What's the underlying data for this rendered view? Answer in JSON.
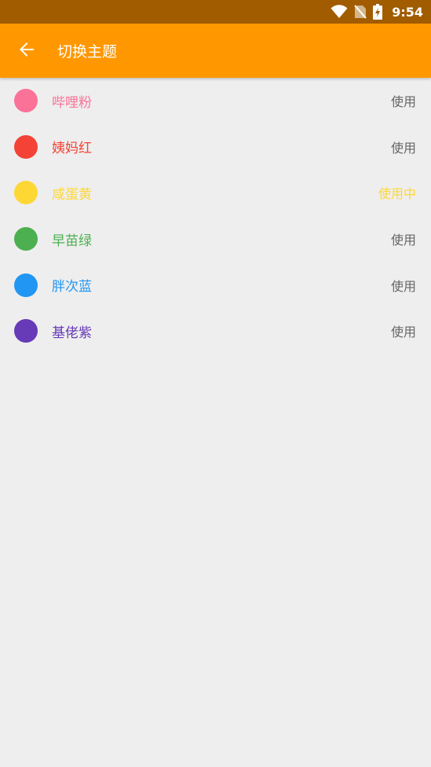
{
  "status_bar": {
    "time": "9:54",
    "icons": [
      "wifi-icon",
      "no-sim-icon",
      "battery-charging-icon"
    ]
  },
  "app_bar": {
    "title": "切换主题",
    "back_icon": "arrow-back-icon"
  },
  "themes": [
    {
      "name": "哔哩粉",
      "color": "#fb7299",
      "action": "使用",
      "active": false
    },
    {
      "name": "姨妈红",
      "color": "#f44336",
      "action": "使用",
      "active": false
    },
    {
      "name": "咸蛋黄",
      "color": "#fdd835",
      "action": "使用中",
      "active": true
    },
    {
      "name": "早苗绿",
      "color": "#4caf50",
      "action": "使用",
      "active": false
    },
    {
      "name": "胖次蓝",
      "color": "#2196f3",
      "action": "使用",
      "active": false
    },
    {
      "name": "基佬紫",
      "color": "#673ab7",
      "action": "使用",
      "active": false
    }
  ]
}
